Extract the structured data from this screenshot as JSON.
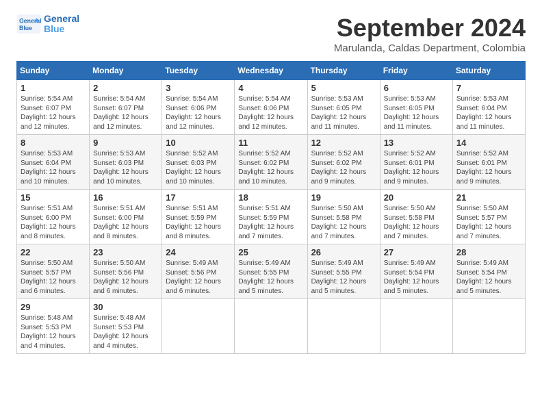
{
  "header": {
    "logo_line1": "General",
    "logo_line2": "Blue",
    "month": "September 2024",
    "location": "Marulanda, Caldas Department, Colombia"
  },
  "weekdays": [
    "Sunday",
    "Monday",
    "Tuesday",
    "Wednesday",
    "Thursday",
    "Friday",
    "Saturday"
  ],
  "weeks": [
    [
      {
        "day": "1",
        "sunrise": "5:54 AM",
        "sunset": "6:07 PM",
        "daylight": "12 hours and 12 minutes."
      },
      {
        "day": "2",
        "sunrise": "5:54 AM",
        "sunset": "6:07 PM",
        "daylight": "12 hours and 12 minutes."
      },
      {
        "day": "3",
        "sunrise": "5:54 AM",
        "sunset": "6:06 PM",
        "daylight": "12 hours and 12 minutes."
      },
      {
        "day": "4",
        "sunrise": "5:54 AM",
        "sunset": "6:06 PM",
        "daylight": "12 hours and 12 minutes."
      },
      {
        "day": "5",
        "sunrise": "5:53 AM",
        "sunset": "6:05 PM",
        "daylight": "12 hours and 11 minutes."
      },
      {
        "day": "6",
        "sunrise": "5:53 AM",
        "sunset": "6:05 PM",
        "daylight": "12 hours and 11 minutes."
      },
      {
        "day": "7",
        "sunrise": "5:53 AM",
        "sunset": "6:04 PM",
        "daylight": "12 hours and 11 minutes."
      }
    ],
    [
      {
        "day": "8",
        "sunrise": "5:53 AM",
        "sunset": "6:04 PM",
        "daylight": "12 hours and 10 minutes."
      },
      {
        "day": "9",
        "sunrise": "5:53 AM",
        "sunset": "6:03 PM",
        "daylight": "12 hours and 10 minutes."
      },
      {
        "day": "10",
        "sunrise": "5:52 AM",
        "sunset": "6:03 PM",
        "daylight": "12 hours and 10 minutes."
      },
      {
        "day": "11",
        "sunrise": "5:52 AM",
        "sunset": "6:02 PM",
        "daylight": "12 hours and 10 minutes."
      },
      {
        "day": "12",
        "sunrise": "5:52 AM",
        "sunset": "6:02 PM",
        "daylight": "12 hours and 9 minutes."
      },
      {
        "day": "13",
        "sunrise": "5:52 AM",
        "sunset": "6:01 PM",
        "daylight": "12 hours and 9 minutes."
      },
      {
        "day": "14",
        "sunrise": "5:52 AM",
        "sunset": "6:01 PM",
        "daylight": "12 hours and 9 minutes."
      }
    ],
    [
      {
        "day": "15",
        "sunrise": "5:51 AM",
        "sunset": "6:00 PM",
        "daylight": "12 hours and 8 minutes."
      },
      {
        "day": "16",
        "sunrise": "5:51 AM",
        "sunset": "6:00 PM",
        "daylight": "12 hours and 8 minutes."
      },
      {
        "day": "17",
        "sunrise": "5:51 AM",
        "sunset": "5:59 PM",
        "daylight": "12 hours and 8 minutes."
      },
      {
        "day": "18",
        "sunrise": "5:51 AM",
        "sunset": "5:59 PM",
        "daylight": "12 hours and 7 minutes."
      },
      {
        "day": "19",
        "sunrise": "5:50 AM",
        "sunset": "5:58 PM",
        "daylight": "12 hours and 7 minutes."
      },
      {
        "day": "20",
        "sunrise": "5:50 AM",
        "sunset": "5:58 PM",
        "daylight": "12 hours and 7 minutes."
      },
      {
        "day": "21",
        "sunrise": "5:50 AM",
        "sunset": "5:57 PM",
        "daylight": "12 hours and 7 minutes."
      }
    ],
    [
      {
        "day": "22",
        "sunrise": "5:50 AM",
        "sunset": "5:57 PM",
        "daylight": "12 hours and 6 minutes."
      },
      {
        "day": "23",
        "sunrise": "5:50 AM",
        "sunset": "5:56 PM",
        "daylight": "12 hours and 6 minutes."
      },
      {
        "day": "24",
        "sunrise": "5:49 AM",
        "sunset": "5:56 PM",
        "daylight": "12 hours and 6 minutes."
      },
      {
        "day": "25",
        "sunrise": "5:49 AM",
        "sunset": "5:55 PM",
        "daylight": "12 hours and 5 minutes."
      },
      {
        "day": "26",
        "sunrise": "5:49 AM",
        "sunset": "5:55 PM",
        "daylight": "12 hours and 5 minutes."
      },
      {
        "day": "27",
        "sunrise": "5:49 AM",
        "sunset": "5:54 PM",
        "daylight": "12 hours and 5 minutes."
      },
      {
        "day": "28",
        "sunrise": "5:49 AM",
        "sunset": "5:54 PM",
        "daylight": "12 hours and 5 minutes."
      }
    ],
    [
      {
        "day": "29",
        "sunrise": "5:48 AM",
        "sunset": "5:53 PM",
        "daylight": "12 hours and 4 minutes."
      },
      {
        "day": "30",
        "sunrise": "5:48 AM",
        "sunset": "5:53 PM",
        "daylight": "12 hours and 4 minutes."
      },
      null,
      null,
      null,
      null,
      null
    ]
  ],
  "labels": {
    "sunrise": "Sunrise:",
    "sunset": "Sunset:",
    "daylight": "Daylight:"
  }
}
